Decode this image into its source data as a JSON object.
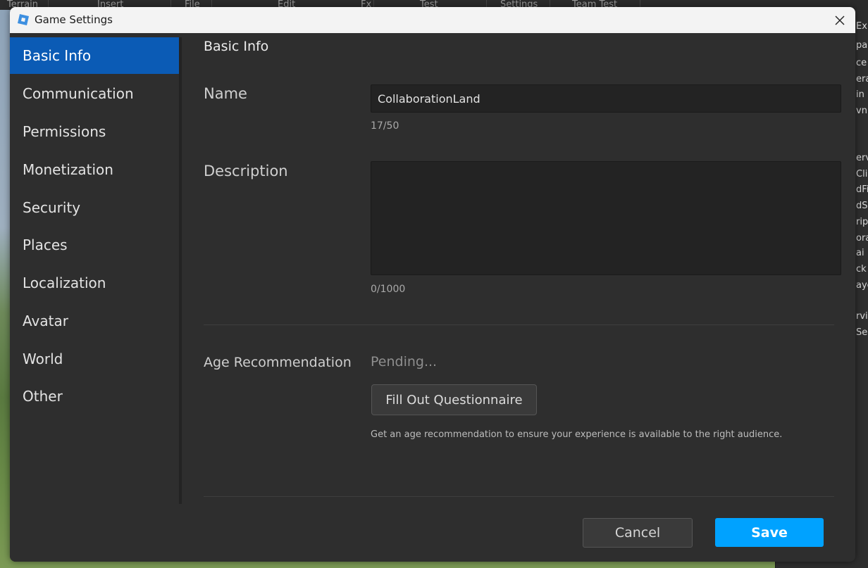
{
  "background": {
    "menu_items": [
      "Terrain",
      "Insert",
      "File",
      "Edit",
      "Fx",
      "Test",
      "Settings",
      "Team Test"
    ],
    "explorer_title": "Explor",
    "explorer_rows": [
      "pac",
      "ce",
      "era",
      "in",
      "vnL",
      "erv",
      "Clie",
      "dFi",
      "dS",
      "ript",
      "orag",
      "ai",
      "ck",
      "aye",
      "rvic",
      "Ser"
    ]
  },
  "dialog": {
    "title": "Game Settings",
    "sidebar": {
      "items": [
        {
          "label": "Basic Info",
          "active": true
        },
        {
          "label": "Communication"
        },
        {
          "label": "Permissions"
        },
        {
          "label": "Monetization"
        },
        {
          "label": "Security"
        },
        {
          "label": "Places"
        },
        {
          "label": "Localization"
        },
        {
          "label": "Avatar"
        },
        {
          "label": "World"
        },
        {
          "label": "Other"
        }
      ]
    },
    "content": {
      "section_title": "Basic Info",
      "name": {
        "label": "Name",
        "value": "CollaborationLand",
        "counter": "17/50"
      },
      "description": {
        "label": "Description",
        "value": "",
        "counter": "0/1000"
      },
      "age": {
        "label": "Age Recommendation",
        "status": "Pending...",
        "button": "Fill Out Questionnaire",
        "hint": "Get an age recommendation to ensure your experience is available to the right audience."
      }
    },
    "footer": {
      "cancel": "Cancel",
      "save": "Save"
    }
  },
  "colors": {
    "accent": "#00a2ff",
    "active_nav": "#0b5bb5",
    "panel": "#2e2e2e"
  }
}
